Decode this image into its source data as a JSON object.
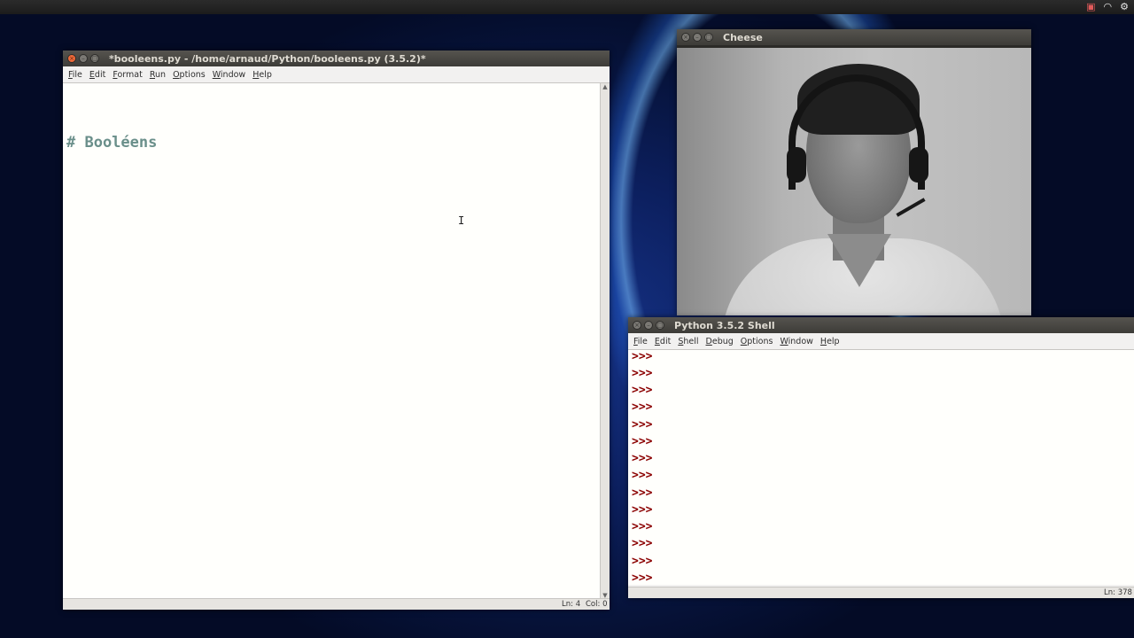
{
  "tray": {
    "camera_icon": "▣",
    "wifi_icon": "◠",
    "settings_icon": "⚙"
  },
  "editor": {
    "title": "*booleens.py - /home/arnaud/Python/booleens.py (3.5.2)*",
    "menu": [
      "File",
      "Edit",
      "Format",
      "Run",
      "Options",
      "Window",
      "Help"
    ],
    "code": "# Booléens",
    "status_line": "Ln: 4",
    "status_col": "Col: 0"
  },
  "cheese": {
    "title": "Cheese"
  },
  "shell": {
    "title": "Python 3.5.2 Shell",
    "menu": [
      "File",
      "Edit",
      "Shell",
      "Debug",
      "Options",
      "Window",
      "Help"
    ],
    "prompts": [
      ">>>",
      ">>>",
      ">>>",
      ">>>",
      ">>>",
      ">>>",
      ">>>",
      ">>>",
      ">>>",
      ">>>",
      ">>>",
      ">>>",
      ">>>",
      ">>>"
    ],
    "status_line": "Ln: 378"
  }
}
